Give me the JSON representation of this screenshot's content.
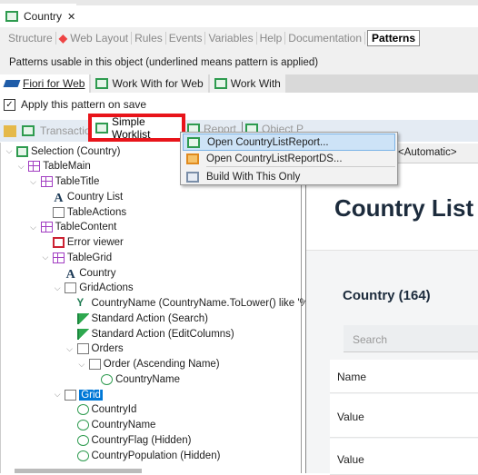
{
  "document_tab": {
    "title": "Country",
    "close": "✕"
  },
  "editor_tabs": [
    "Structure",
    "Web Layout",
    "Rules",
    "Events",
    "Variables",
    "Help",
    "Documentation",
    "Patterns"
  ],
  "active_editor_tab": "Patterns",
  "info_text": "Patterns usable in this object (underlined means pattern is applied)",
  "pattern_tabs": [
    "Fiori for Web",
    "Work With for Web",
    "Work With"
  ],
  "active_pattern_tab": "Fiori for Web",
  "apply_checkbox": {
    "label": "Apply this pattern on save",
    "checked": true
  },
  "toolbar": {
    "transaction": "Transaction",
    "simple_worklist": "Simple Worklist",
    "other1": "Report",
    "other2": "Object P"
  },
  "context_menu": [
    {
      "label": "Open CountryListReport...",
      "icon": "webpanel-icon",
      "highlighted": true
    },
    {
      "label": "Open CountryListReportDS...",
      "icon": "dataselector-icon"
    },
    {
      "label": "Build With This Only",
      "icon": "build-icon"
    }
  ],
  "tree": [
    {
      "label": "Selection (Country)",
      "level": 0,
      "icon": "webpanel",
      "expanded": true
    },
    {
      "label": "TableMain",
      "level": 1,
      "icon": "table",
      "expanded": true
    },
    {
      "label": "TableTitle",
      "level": 2,
      "icon": "table",
      "expanded": true
    },
    {
      "label": "Country List",
      "level": 3,
      "icon": "text"
    },
    {
      "label": "TableActions",
      "level": 3,
      "icon": "gridtable"
    },
    {
      "label": "TableContent",
      "level": 2,
      "icon": "table",
      "expanded": true
    },
    {
      "label": "Error viewer",
      "level": 3,
      "icon": "errorviewer"
    },
    {
      "label": "TableGrid",
      "level": 3,
      "icon": "table",
      "expanded": true
    },
    {
      "label": "Country",
      "level": 4,
      "icon": "text"
    },
    {
      "label": "GridActions",
      "level": 4,
      "icon": "gridtable",
      "expanded": true
    },
    {
      "label": "CountryName (CountryName.ToLower() like '%",
      "level": 5,
      "icon": "filter"
    },
    {
      "label": "Standard Action (Search)",
      "level": 5,
      "icon": "flag"
    },
    {
      "label": "Standard Action (EditColumns)",
      "level": 5,
      "icon": "flag"
    },
    {
      "label": "Orders",
      "level": 5,
      "icon": "orders",
      "expanded": true
    },
    {
      "label": "Order (Ascending Name)",
      "level": 6,
      "icon": "order",
      "expanded": true
    },
    {
      "label": "CountryName",
      "level": 7,
      "icon": "attribute"
    },
    {
      "label": "Grid",
      "level": 4,
      "icon": "grid",
      "expanded": true,
      "selected": true
    },
    {
      "label": "CountryId",
      "level": 5,
      "icon": "attribute"
    },
    {
      "label": "CountryName",
      "level": 5,
      "icon": "attribute"
    },
    {
      "label": "CountryFlag (Hidden)",
      "level": 5,
      "icon": "attribute"
    },
    {
      "label": "CountryPopulation (Hidden)",
      "level": 5,
      "icon": "attribute"
    }
  ],
  "right_header": "<Automatic>",
  "preview": {
    "title": "Country List",
    "count_title": "Country (164)",
    "search_placeholder": "Search",
    "rows": [
      "Name",
      "Value",
      "Value"
    ]
  },
  "colors": {
    "highlight_box": "#e8141a",
    "selection": "#0078d7",
    "menu_highlight": "#cde3f7"
  }
}
